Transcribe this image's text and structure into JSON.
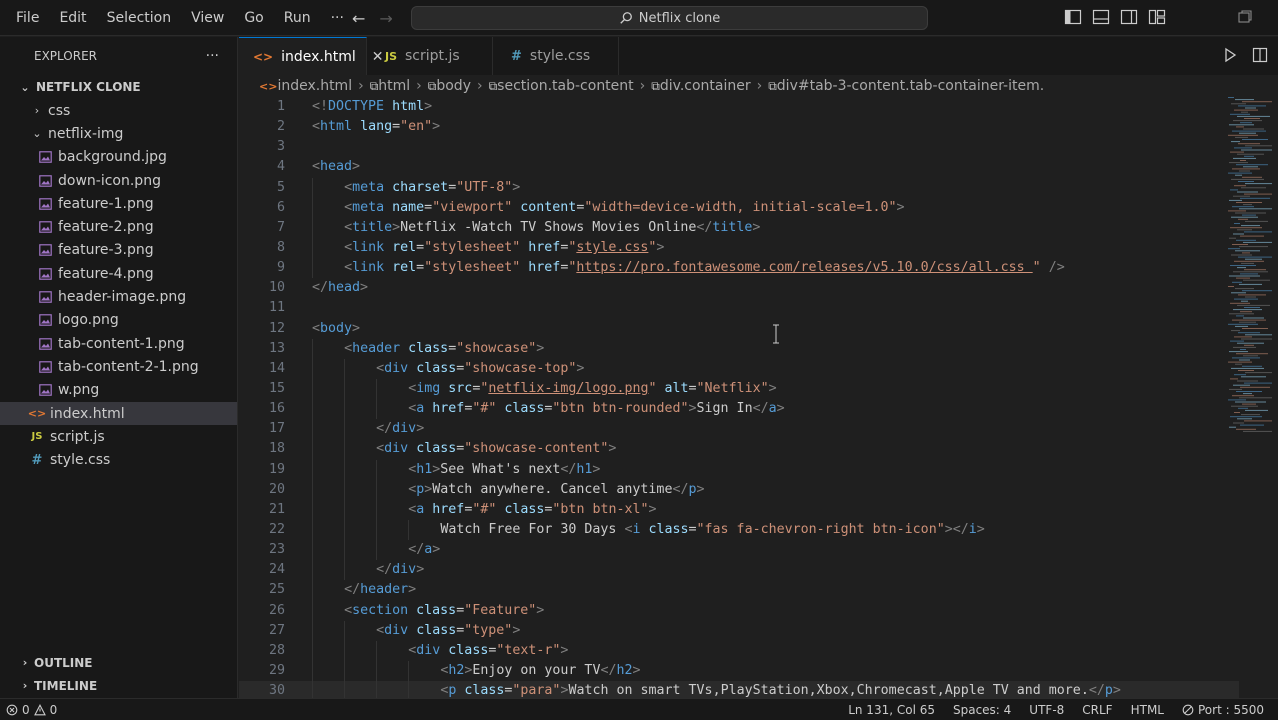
{
  "menu": [
    "File",
    "Edit",
    "Selection",
    "View",
    "Go",
    "Run",
    "···"
  ],
  "search_box": "Netflix clone",
  "explorer": {
    "title": "EXPLORER",
    "more": "···",
    "root": "NETFLIX CLONE",
    "items": [
      {
        "label": "css",
        "type": "folder-collapsed",
        "depth": 1
      },
      {
        "label": "netflix-img",
        "type": "folder-open",
        "depth": 1
      },
      {
        "label": "background.jpg",
        "type": "image",
        "depth": 2
      },
      {
        "label": "down-icon.png",
        "type": "image",
        "depth": 2
      },
      {
        "label": "feature-1.png",
        "type": "image",
        "depth": 2
      },
      {
        "label": "feature-2.png",
        "type": "image",
        "depth": 2
      },
      {
        "label": "feature-3.png",
        "type": "image",
        "depth": 2
      },
      {
        "label": "feature-4.png",
        "type": "image",
        "depth": 2
      },
      {
        "label": "header-image.png",
        "type": "image",
        "depth": 2
      },
      {
        "label": "logo.png",
        "type": "image",
        "depth": 2
      },
      {
        "label": "tab-content-1.png",
        "type": "image",
        "depth": 2
      },
      {
        "label": "tab-content-2-1.png",
        "type": "image",
        "depth": 2
      },
      {
        "label": "w.png",
        "type": "image",
        "depth": 2
      },
      {
        "label": "index.html",
        "type": "html",
        "depth": 1,
        "selected": true
      },
      {
        "label": "script.js",
        "type": "js",
        "depth": 1
      },
      {
        "label": "style.css",
        "type": "css",
        "depth": 1
      }
    ],
    "outline": "OUTLINE",
    "timeline": "TIMELINE"
  },
  "tabs": [
    {
      "label": "index.html",
      "icon": "html",
      "active": true,
      "close": "✕"
    },
    {
      "label": "script.js",
      "icon": "js",
      "active": false
    },
    {
      "label": "style.css",
      "icon": "css",
      "active": false
    }
  ],
  "breadcrumbs": [
    "index.html",
    "html",
    "body",
    "section.tab-content",
    "div.container",
    "div#tab-3-content.tab-container-item."
  ],
  "code_lines": [
    {
      "n": "1",
      "i": 0,
      "parts": [
        [
          "p",
          "<!"
        ],
        [
          "t",
          "DOCTYPE"
        ],
        [
          "tx",
          " "
        ],
        [
          "a",
          "html"
        ],
        [
          "p",
          ">"
        ]
      ]
    },
    {
      "n": "2",
      "i": 0,
      "parts": [
        [
          "p",
          "<"
        ],
        [
          "t",
          "html"
        ],
        [
          "tx",
          " "
        ],
        [
          "a",
          "lang"
        ],
        [
          "tx",
          "="
        ],
        [
          "s",
          "\"en\""
        ],
        [
          "p",
          ">"
        ]
      ]
    },
    {
      "n": "3",
      "i": 0,
      "parts": []
    },
    {
      "n": "4",
      "i": 0,
      "parts": [
        [
          "p",
          "<"
        ],
        [
          "t",
          "head"
        ],
        [
          "p",
          ">"
        ]
      ]
    },
    {
      "n": "5",
      "i": 1,
      "parts": [
        [
          "p",
          "<"
        ],
        [
          "t",
          "meta"
        ],
        [
          "tx",
          " "
        ],
        [
          "a",
          "charset"
        ],
        [
          "tx",
          "="
        ],
        [
          "s",
          "\"UTF-8\""
        ],
        [
          "p",
          ">"
        ]
      ]
    },
    {
      "n": "6",
      "i": 1,
      "parts": [
        [
          "p",
          "<"
        ],
        [
          "t",
          "meta"
        ],
        [
          "tx",
          " "
        ],
        [
          "a",
          "name"
        ],
        [
          "tx",
          "="
        ],
        [
          "s",
          "\"viewport\""
        ],
        [
          "tx",
          " "
        ],
        [
          "a",
          "content"
        ],
        [
          "tx",
          "="
        ],
        [
          "s",
          "\"width=device-width, initial-scale=1.0\""
        ],
        [
          "p",
          ">"
        ]
      ]
    },
    {
      "n": "7",
      "i": 1,
      "parts": [
        [
          "p",
          "<"
        ],
        [
          "t",
          "title"
        ],
        [
          "p",
          ">"
        ],
        [
          "tx",
          "Netflix -Watch TV Shows Movies Online"
        ],
        [
          "p",
          "</"
        ],
        [
          "t",
          "title"
        ],
        [
          "p",
          ">"
        ]
      ]
    },
    {
      "n": "8",
      "i": 1,
      "parts": [
        [
          "p",
          "<"
        ],
        [
          "t",
          "link"
        ],
        [
          "tx",
          " "
        ],
        [
          "a",
          "rel"
        ],
        [
          "tx",
          "="
        ],
        [
          "s",
          "\"stylesheet\""
        ],
        [
          "tx",
          " "
        ],
        [
          "a",
          "href"
        ],
        [
          "tx",
          "="
        ],
        [
          "s",
          "\""
        ],
        [
          "su",
          "style.css"
        ],
        [
          "s",
          "\""
        ],
        [
          "p",
          ">"
        ]
      ]
    },
    {
      "n": "9",
      "i": 1,
      "parts": [
        [
          "p",
          "<"
        ],
        [
          "t",
          "link"
        ],
        [
          "tx",
          " "
        ],
        [
          "a",
          "rel"
        ],
        [
          "tx",
          "="
        ],
        [
          "s",
          "\"stylesheet\""
        ],
        [
          "tx",
          " "
        ],
        [
          "a",
          "href"
        ],
        [
          "tx",
          "="
        ],
        [
          "s",
          "\""
        ],
        [
          "su",
          "https://pro.fontawesome.com/releases/v5.10.0/css/all.css "
        ],
        [
          "s",
          "\""
        ],
        [
          "tx",
          " "
        ],
        [
          "p",
          "/>"
        ]
      ]
    },
    {
      "n": "10",
      "i": 0,
      "parts": [
        [
          "p",
          "</"
        ],
        [
          "t",
          "head"
        ],
        [
          "p",
          ">"
        ]
      ]
    },
    {
      "n": "11",
      "i": 0,
      "parts": []
    },
    {
      "n": "12",
      "i": 0,
      "parts": [
        [
          "p",
          "<"
        ],
        [
          "t",
          "body"
        ],
        [
          "p",
          ">"
        ]
      ]
    },
    {
      "n": "13",
      "i": 1,
      "parts": [
        [
          "p",
          "<"
        ],
        [
          "t",
          "header"
        ],
        [
          "tx",
          " "
        ],
        [
          "a",
          "class"
        ],
        [
          "tx",
          "="
        ],
        [
          "s",
          "\"showcase\""
        ],
        [
          "p",
          ">"
        ]
      ]
    },
    {
      "n": "14",
      "i": 2,
      "parts": [
        [
          "p",
          "<"
        ],
        [
          "t",
          "div"
        ],
        [
          "tx",
          " "
        ],
        [
          "a",
          "class"
        ],
        [
          "tx",
          "="
        ],
        [
          "s",
          "\"showcase-top\""
        ],
        [
          "p",
          ">"
        ]
      ]
    },
    {
      "n": "15",
      "i": 3,
      "parts": [
        [
          "p",
          "<"
        ],
        [
          "t",
          "img"
        ],
        [
          "tx",
          " "
        ],
        [
          "a",
          "src"
        ],
        [
          "tx",
          "="
        ],
        [
          "s",
          "\""
        ],
        [
          "su",
          "netflix-img/logo.png"
        ],
        [
          "s",
          "\""
        ],
        [
          "tx",
          " "
        ],
        [
          "a",
          "alt"
        ],
        [
          "tx",
          "="
        ],
        [
          "s",
          "\"Netflix\""
        ],
        [
          "p",
          ">"
        ]
      ]
    },
    {
      "n": "16",
      "i": 3,
      "parts": [
        [
          "p",
          "<"
        ],
        [
          "t",
          "a"
        ],
        [
          "tx",
          " "
        ],
        [
          "a",
          "href"
        ],
        [
          "tx",
          "="
        ],
        [
          "s",
          "\"#\""
        ],
        [
          "tx",
          " "
        ],
        [
          "a",
          "class"
        ],
        [
          "tx",
          "="
        ],
        [
          "s",
          "\"btn btn-rounded\""
        ],
        [
          "p",
          ">"
        ],
        [
          "tx",
          "Sign In"
        ],
        [
          "p",
          "</"
        ],
        [
          "t",
          "a"
        ],
        [
          "p",
          ">"
        ]
      ]
    },
    {
      "n": "17",
      "i": 2,
      "parts": [
        [
          "p",
          "</"
        ],
        [
          "t",
          "div"
        ],
        [
          "p",
          ">"
        ]
      ]
    },
    {
      "n": "18",
      "i": 2,
      "parts": [
        [
          "p",
          "<"
        ],
        [
          "t",
          "div"
        ],
        [
          "tx",
          " "
        ],
        [
          "a",
          "class"
        ],
        [
          "tx",
          "="
        ],
        [
          "s",
          "\"showcase-content\""
        ],
        [
          "p",
          ">"
        ]
      ]
    },
    {
      "n": "19",
      "i": 3,
      "parts": [
        [
          "p",
          "<"
        ],
        [
          "t",
          "h1"
        ],
        [
          "p",
          ">"
        ],
        [
          "tx",
          "See What's next"
        ],
        [
          "p",
          "</"
        ],
        [
          "t",
          "h1"
        ],
        [
          "p",
          ">"
        ]
      ]
    },
    {
      "n": "20",
      "i": 3,
      "parts": [
        [
          "p",
          "<"
        ],
        [
          "t",
          "p"
        ],
        [
          "p",
          ">"
        ],
        [
          "tx",
          "Watch anywhere. Cancel anytime"
        ],
        [
          "p",
          "</"
        ],
        [
          "t",
          "p"
        ],
        [
          "p",
          ">"
        ]
      ]
    },
    {
      "n": "21",
      "i": 3,
      "parts": [
        [
          "p",
          "<"
        ],
        [
          "t",
          "a"
        ],
        [
          "tx",
          " "
        ],
        [
          "a",
          "href"
        ],
        [
          "tx",
          "="
        ],
        [
          "s",
          "\"#\""
        ],
        [
          "tx",
          " "
        ],
        [
          "a",
          "class"
        ],
        [
          "tx",
          "="
        ],
        [
          "s",
          "\"btn btn-xl\""
        ],
        [
          "p",
          ">"
        ]
      ]
    },
    {
      "n": "22",
      "i": 4,
      "parts": [
        [
          "tx",
          "Watch Free For 30 Days "
        ],
        [
          "p",
          "<"
        ],
        [
          "t",
          "i"
        ],
        [
          "tx",
          " "
        ],
        [
          "a",
          "class"
        ],
        [
          "tx",
          "="
        ],
        [
          "s",
          "\"fas fa-chevron-right btn-icon\""
        ],
        [
          "p",
          "></"
        ],
        [
          "t",
          "i"
        ],
        [
          "p",
          ">"
        ]
      ]
    },
    {
      "n": "23",
      "i": 3,
      "parts": [
        [
          "p",
          "</"
        ],
        [
          "t",
          "a"
        ],
        [
          "p",
          ">"
        ]
      ]
    },
    {
      "n": "24",
      "i": 2,
      "parts": [
        [
          "p",
          "</"
        ],
        [
          "t",
          "div"
        ],
        [
          "p",
          ">"
        ]
      ]
    },
    {
      "n": "25",
      "i": 1,
      "parts": [
        [
          "p",
          "</"
        ],
        [
          "t",
          "header"
        ],
        [
          "p",
          ">"
        ]
      ]
    },
    {
      "n": "26",
      "i": 1,
      "parts": [
        [
          "p",
          "<"
        ],
        [
          "t",
          "section"
        ],
        [
          "tx",
          " "
        ],
        [
          "a",
          "class"
        ],
        [
          "tx",
          "="
        ],
        [
          "s",
          "\"Feature\""
        ],
        [
          "p",
          ">"
        ]
      ]
    },
    {
      "n": "27",
      "i": 2,
      "parts": [
        [
          "p",
          "<"
        ],
        [
          "t",
          "div"
        ],
        [
          "tx",
          " "
        ],
        [
          "a",
          "class"
        ],
        [
          "tx",
          "="
        ],
        [
          "s",
          "\"type\""
        ],
        [
          "p",
          ">"
        ]
      ]
    },
    {
      "n": "28",
      "i": 3,
      "parts": [
        [
          "p",
          "<"
        ],
        [
          "t",
          "div"
        ],
        [
          "tx",
          " "
        ],
        [
          "a",
          "class"
        ],
        [
          "tx",
          "="
        ],
        [
          "s",
          "\"text-r\""
        ],
        [
          "p",
          ">"
        ]
      ]
    },
    {
      "n": "29",
      "i": 4,
      "parts": [
        [
          "p",
          "<"
        ],
        [
          "t",
          "h2"
        ],
        [
          "p",
          ">"
        ],
        [
          "tx",
          "Enjoy on your TV"
        ],
        [
          "p",
          "</"
        ],
        [
          "t",
          "h2"
        ],
        [
          "p",
          ">"
        ]
      ]
    },
    {
      "n": "30",
      "i": 4,
      "parts": [
        [
          "p",
          "<"
        ],
        [
          "t",
          "p"
        ],
        [
          "tx",
          " "
        ],
        [
          "a",
          "class"
        ],
        [
          "tx",
          "="
        ],
        [
          "s",
          "\"para\""
        ],
        [
          "p",
          ">"
        ],
        [
          "tx",
          "Watch on smart TVs,PlayStation,Xbox,Chromecast,Apple TV and more."
        ],
        [
          "p",
          "</"
        ],
        [
          "t",
          "p"
        ],
        [
          "p",
          ">"
        ]
      ]
    }
  ],
  "status": {
    "errors": "0",
    "warnings": "0",
    "position": "Ln 131, Col 65",
    "spaces": "Spaces: 4",
    "encoding": "UTF-8",
    "eol": "CRLF",
    "language": "HTML",
    "port": "Port : 5500"
  },
  "colors": {
    "accent": "#0078d4",
    "tag": "#569cd6",
    "attr": "#9cdcfe",
    "string": "#ce9178",
    "html_icon": "#e37933",
    "js_icon": "#cbcb41",
    "css_icon": "#519aba",
    "image_icon": "#a074c4"
  }
}
